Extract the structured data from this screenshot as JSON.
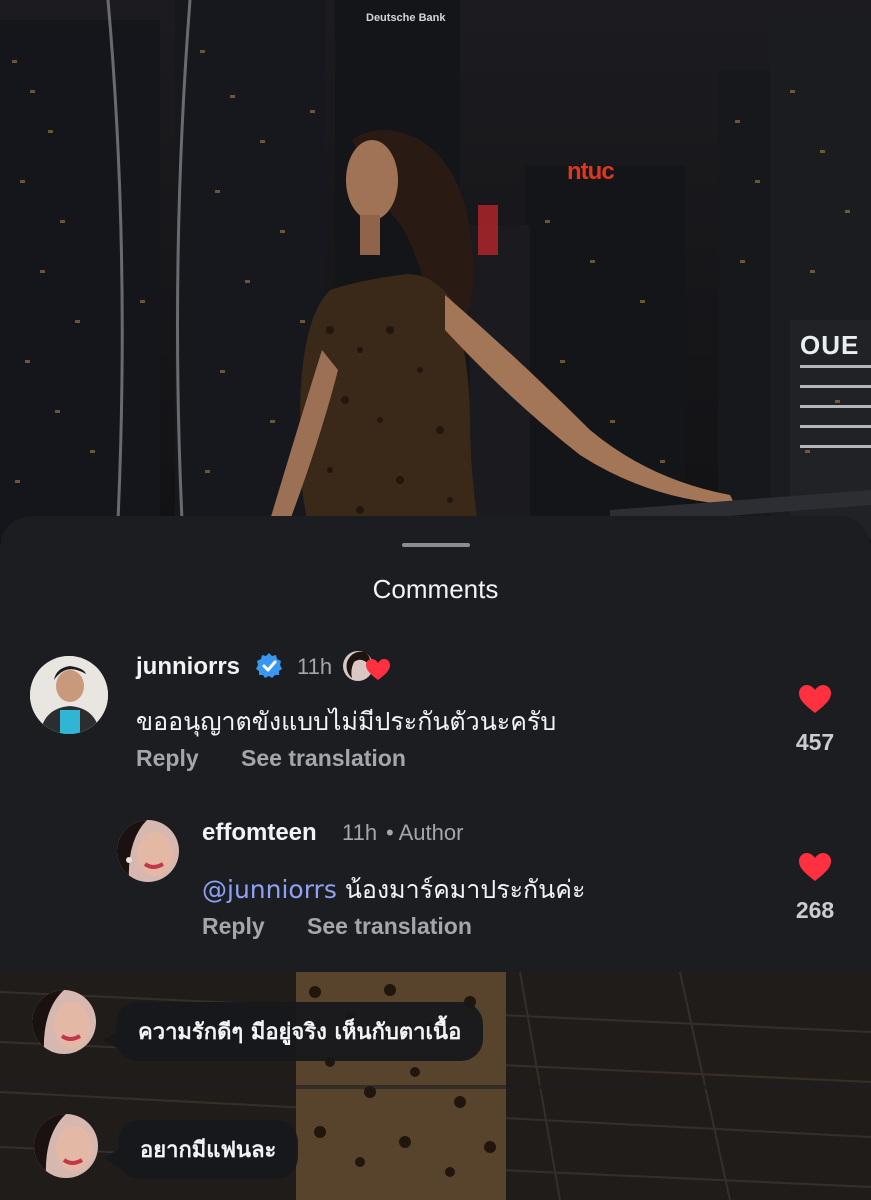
{
  "sheet": {
    "title": "Comments"
  },
  "comments": [
    {
      "username": "junniorrs",
      "verified": true,
      "time": "11h",
      "text": "ขออนุญาตขังแบบไม่มีประกันตัวนะครับ",
      "reply_label": "Reply",
      "translate_label": "See translation",
      "likes": "457",
      "liked_by_author": true
    },
    {
      "username": "effomteen",
      "time": "11h",
      "author_tag": "• Author",
      "mention": "@junniorrs",
      "text": " น้องมาร์คมาประกันค่ะ",
      "reply_label": "Reply",
      "translate_label": "See translation",
      "likes": "268"
    }
  ],
  "live_comments": [
    {
      "text": "ความรักดีๆ มีอยู่จริง เห็นกับตาเนื้อ"
    },
    {
      "text": "อยากมีแฟนละ"
    }
  ],
  "photo_signs": {
    "ntuc": "ntuc",
    "oue": "OUE",
    "deutsche": "Deutsche Bank"
  },
  "colors": {
    "sheet_bg": "#1c1d21",
    "heart": "#ff3040",
    "mention": "#8ea1f5",
    "verified": "#3897f0"
  }
}
